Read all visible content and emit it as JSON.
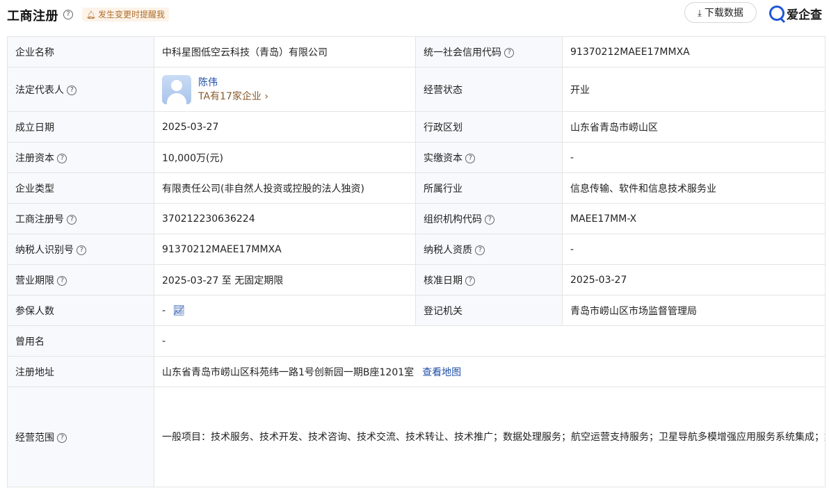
{
  "header": {
    "title": "工商注册",
    "help_icon": "question-circle-icon",
    "alert_label": "发生变更时提醒我",
    "download_label": "下载数据",
    "logo_text": "爱企查"
  },
  "rows": {
    "company_name": {
      "label": "企业名称",
      "value": "中科星图低空云科技（青岛）有限公司"
    },
    "credit_code": {
      "label": "统一社会信用代码",
      "value": "91370212MAEE17MMXA"
    },
    "legal_rep": {
      "label": "法定代表人",
      "name": "陈伟",
      "sub": "TA有17家企业"
    },
    "status": {
      "label": "经营状态",
      "value": "开业"
    },
    "founded": {
      "label": "成立日期",
      "value": "2025-03-27"
    },
    "region": {
      "label": "行政区划",
      "value": "山东省青岛市崂山区"
    },
    "capital": {
      "label": "注册资本",
      "value": "10,000万(元)"
    },
    "paid_capital": {
      "label": "实缴资本",
      "value": "-"
    },
    "company_type": {
      "label": "企业类型",
      "value": "有限责任公司(非自然人投资或控股的法人独资)"
    },
    "industry": {
      "label": "所属行业",
      "value": "信息传输、软件和信息技术服务业"
    },
    "reg_no": {
      "label": "工商注册号",
      "value": "370212230636224"
    },
    "org_code": {
      "label": "组织机构代码",
      "value": "MAEE17MM-X"
    },
    "taxpayer_id": {
      "label": "纳税人识别号",
      "value": "91370212MAEE17MMXA"
    },
    "taxpayer_qual": {
      "label": "纳税人资质",
      "value": "-"
    },
    "term": {
      "label": "营业期限",
      "value": "2025-03-27 至 无固定期限"
    },
    "approve_date": {
      "label": "核准日期",
      "value": "2025-03-27"
    },
    "insured": {
      "label": "参保人数",
      "value": "-"
    },
    "authority": {
      "label": "登记机关",
      "value": "青岛市崂山区市场监督管理局"
    },
    "former_name": {
      "label": "曾用名",
      "value": "-"
    },
    "address": {
      "label": "注册地址",
      "value": "山东省青岛市崂山区科苑纬一路1号创新园一期B座1201室",
      "map_link": "查看地图"
    },
    "scope": {
      "label": "经营范围",
      "value": "一般项目：技术服务、技术开发、技术咨询、技术交流、技术转让、技术推广；数据处理服务；航空运营支持服务；卫星导航多模增强应用服务系统集成；集成电路芯片设计及服务；人工智能行业应用系统集成服务；人工智能基础资源与技术平台；物联网应用服务；信息系统集成服务；大数据服务；工程和技术研究和试验发展；软件销售；软件开发；计算机软硬件及辅助设备零售；计算机软硬件及辅助设备批发；计算机及通讯设备租赁；科普宣传服务；信息技术咨询服务；企业管理咨询；货物进出口；技术进出口；进出口代理；数字内容制作服务（不含出版发行）；电子产品销售。（除依法须经批准的项目外，凭营业执照依法自主开展经营活动）"
    }
  }
}
